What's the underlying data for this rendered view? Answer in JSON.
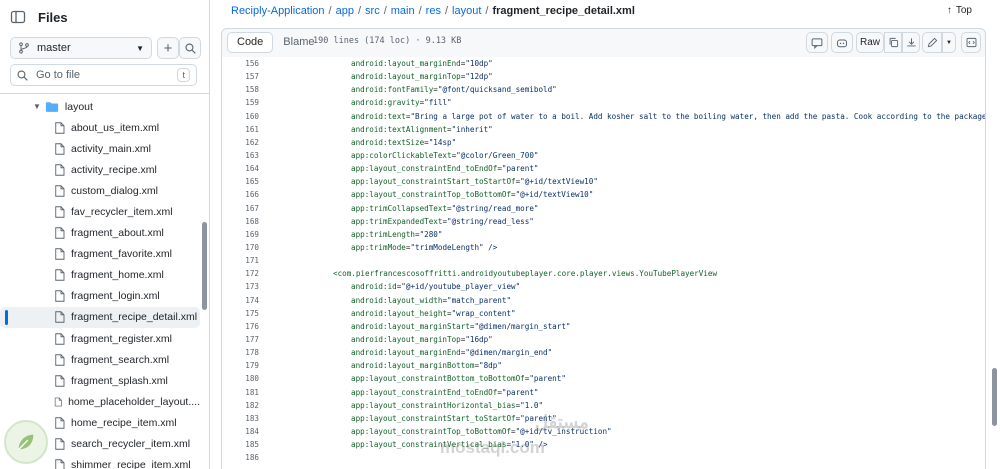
{
  "sidebar": {
    "title": "Files",
    "branch": "master",
    "goto_placeholder": "Go to file",
    "goto_shortcut": "t",
    "folder": "layout",
    "files": [
      "about_us_item.xml",
      "activity_main.xml",
      "activity_recipe.xml",
      "custom_dialog.xml",
      "fav_recycler_item.xml",
      "fragment_about.xml",
      "fragment_favorite.xml",
      "fragment_home.xml",
      "fragment_login.xml",
      "fragment_recipe_detail.xml",
      "fragment_register.xml",
      "fragment_search.xml",
      "fragment_splash.xml",
      "home_placeholder_layout....",
      "home_recipe_item.xml",
      "search_recycler_item.xml",
      "shimmer_recipe_item.xml"
    ],
    "active_file_index": 9
  },
  "header": {
    "crumbs": [
      "Reciply-Application",
      "app",
      "src",
      "main",
      "res",
      "layout"
    ],
    "current": "fragment_recipe_detail.xml",
    "top_label": "Top"
  },
  "toolbar": {
    "code_label": "Code",
    "blame_label": "Blame",
    "meta": "190 lines (174 loc) · 9.13 KB",
    "raw_label": "Raw"
  },
  "code": {
    "lines": [
      {
        "n": "156",
        "a": "android:layout_marginEnd",
        "v": "\"10dp\""
      },
      {
        "n": "157",
        "a": "android:layout_marginTop",
        "v": "\"12dp\""
      },
      {
        "n": "158",
        "a": "android:fontFamily",
        "v": "\"@font/quicksand_semibold\""
      },
      {
        "n": "159",
        "a": "android:gravity",
        "v": "\"fill\""
      },
      {
        "n": "160",
        "a": "android:text",
        "v": "\"Bring a large pot of water to a boil. Add kosher salt to the boiling water, then add the pasta. Cook according to the package instructions\""
      },
      {
        "n": "161",
        "a": "android:textAlignment",
        "v": "\"inherit\""
      },
      {
        "n": "162",
        "a": "android:textSize",
        "v": "\"14sp\""
      },
      {
        "n": "163",
        "a": "app:colorClickableText",
        "v": "\"@color/Green_700\""
      },
      {
        "n": "164",
        "a": "app:layout_constraintEnd_toEndOf",
        "v": "\"parent\""
      },
      {
        "n": "165",
        "a": "app:layout_constraintStart_toStartOf",
        "v": "\"@+id/textView10\""
      },
      {
        "n": "166",
        "a": "app:layout_constraintTop_toBottomOf",
        "v": "\"@+id/textView10\""
      },
      {
        "n": "167",
        "a": "app:trimCollapsedText",
        "v": "\"@string/read_more\""
      },
      {
        "n": "168",
        "a": "app:trimExpandedText",
        "v": "\"@string/read_less\""
      },
      {
        "n": "169",
        "a": "app:trimLength",
        "v": "\"280\""
      },
      {
        "n": "170",
        "a": "app:trimMode",
        "v": "\"trimModeLength\" />"
      },
      {
        "n": "171",
        "a": "",
        "v": ""
      },
      {
        "n": "172",
        "tag": "<com.pierfrancescosoffritti.androidyoutubeplayer.core.player.views.YouTubePlayerView"
      },
      {
        "n": "173",
        "a": "android:id",
        "v": "\"@+id/youtube_player_view\""
      },
      {
        "n": "174",
        "a": "android:layout_width",
        "v": "\"match_parent\""
      },
      {
        "n": "175",
        "a": "android:layout_height",
        "v": "\"wrap_content\""
      },
      {
        "n": "176",
        "a": "android:layout_marginStart",
        "v": "\"@dimen/margin_start\""
      },
      {
        "n": "177",
        "a": "android:layout_marginTop",
        "v": "\"16dp\""
      },
      {
        "n": "178",
        "a": "android:layout_marginEnd",
        "v": "\"@dimen/margin_end\""
      },
      {
        "n": "179",
        "a": "android:layout_marginBottom",
        "v": "\"8dp\""
      },
      {
        "n": "180",
        "a": "app:layout_constraintBottom_toBottomOf",
        "v": "\"parent\""
      },
      {
        "n": "181",
        "a": "app:layout_constraintEnd_toEndOf",
        "v": "\"parent\""
      },
      {
        "n": "182",
        "a": "app:layout_constraintHorizontal_bias",
        "v": "\"1.0\""
      },
      {
        "n": "183",
        "a": "app:layout_constraintStart_toStartOf",
        "v": "\"parent\""
      },
      {
        "n": "184",
        "a": "app:layout_constraintTop_toBottomOf",
        "v": "\"@+id/tv_instruction\""
      },
      {
        "n": "185",
        "a": "app:layout_constraintVertical_bias",
        "v": "\"1.0\" />"
      },
      {
        "n": "186",
        "a": "",
        "v": ""
      }
    ]
  },
  "watermark": {
    "text": "mostaql.com"
  },
  "colors": {
    "link": "#0969da",
    "attr": "#116329",
    "value": "#0a3069",
    "accent": "#0969da"
  }
}
